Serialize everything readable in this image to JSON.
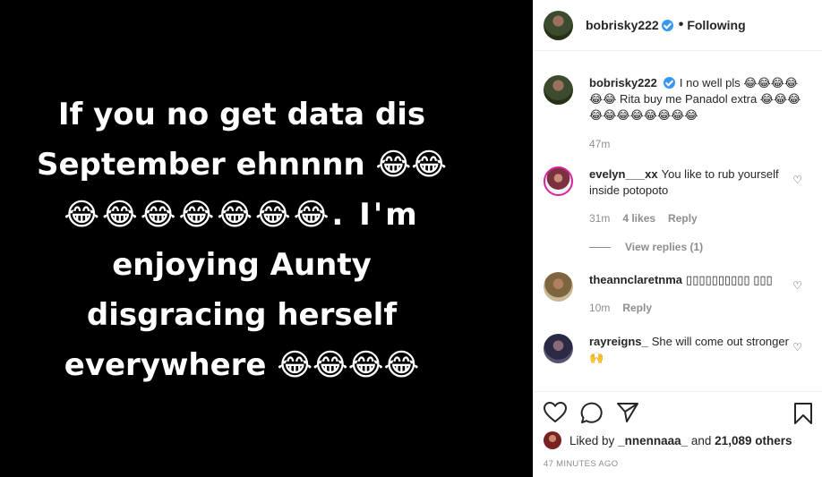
{
  "post": {
    "text_lines": [
      "If you no get data dis",
      "September ehnnnn 😂😂",
      "😂😂😂😂😂😂😂. I'm",
      "enjoying Aunty",
      "disgracing herself",
      "everywhere 😂😂😂😂"
    ]
  },
  "header": {
    "username": "bobrisky222",
    "separator": "•",
    "follow_status": "Following"
  },
  "caption": {
    "username": "bobrisky222",
    "text": "I no well pls 😂😂😂😂😂😂 Rita buy me Panadol extra 😂😂😂😂😂😂😂😂😂😂😂",
    "time": "47m"
  },
  "comments": [
    {
      "username": "evelyn___xx",
      "text": "You like to rub yourself inside potopoto",
      "time": "31m",
      "likes": "4 likes",
      "reply_label": "Reply",
      "view_replies": "View replies (1)"
    },
    {
      "username": "theannclaretnma",
      "text": "▯▯▯▯▯▯▯▯▯▯ ▯▯▯",
      "time": "10m",
      "reply_label": "Reply"
    },
    {
      "username": "rayreigns_",
      "text": "She will come out stronger 🙌"
    }
  ],
  "likes": {
    "prefix": "Liked by",
    "user": "_nnennaaa_",
    "connector": "and",
    "others": "21,089 others"
  },
  "time_ago": "47 MINUTES AGO",
  "icons": [
    "heart-icon",
    "comment-icon",
    "share-icon",
    "bookmark-icon",
    "verified-badge-icon"
  ]
}
